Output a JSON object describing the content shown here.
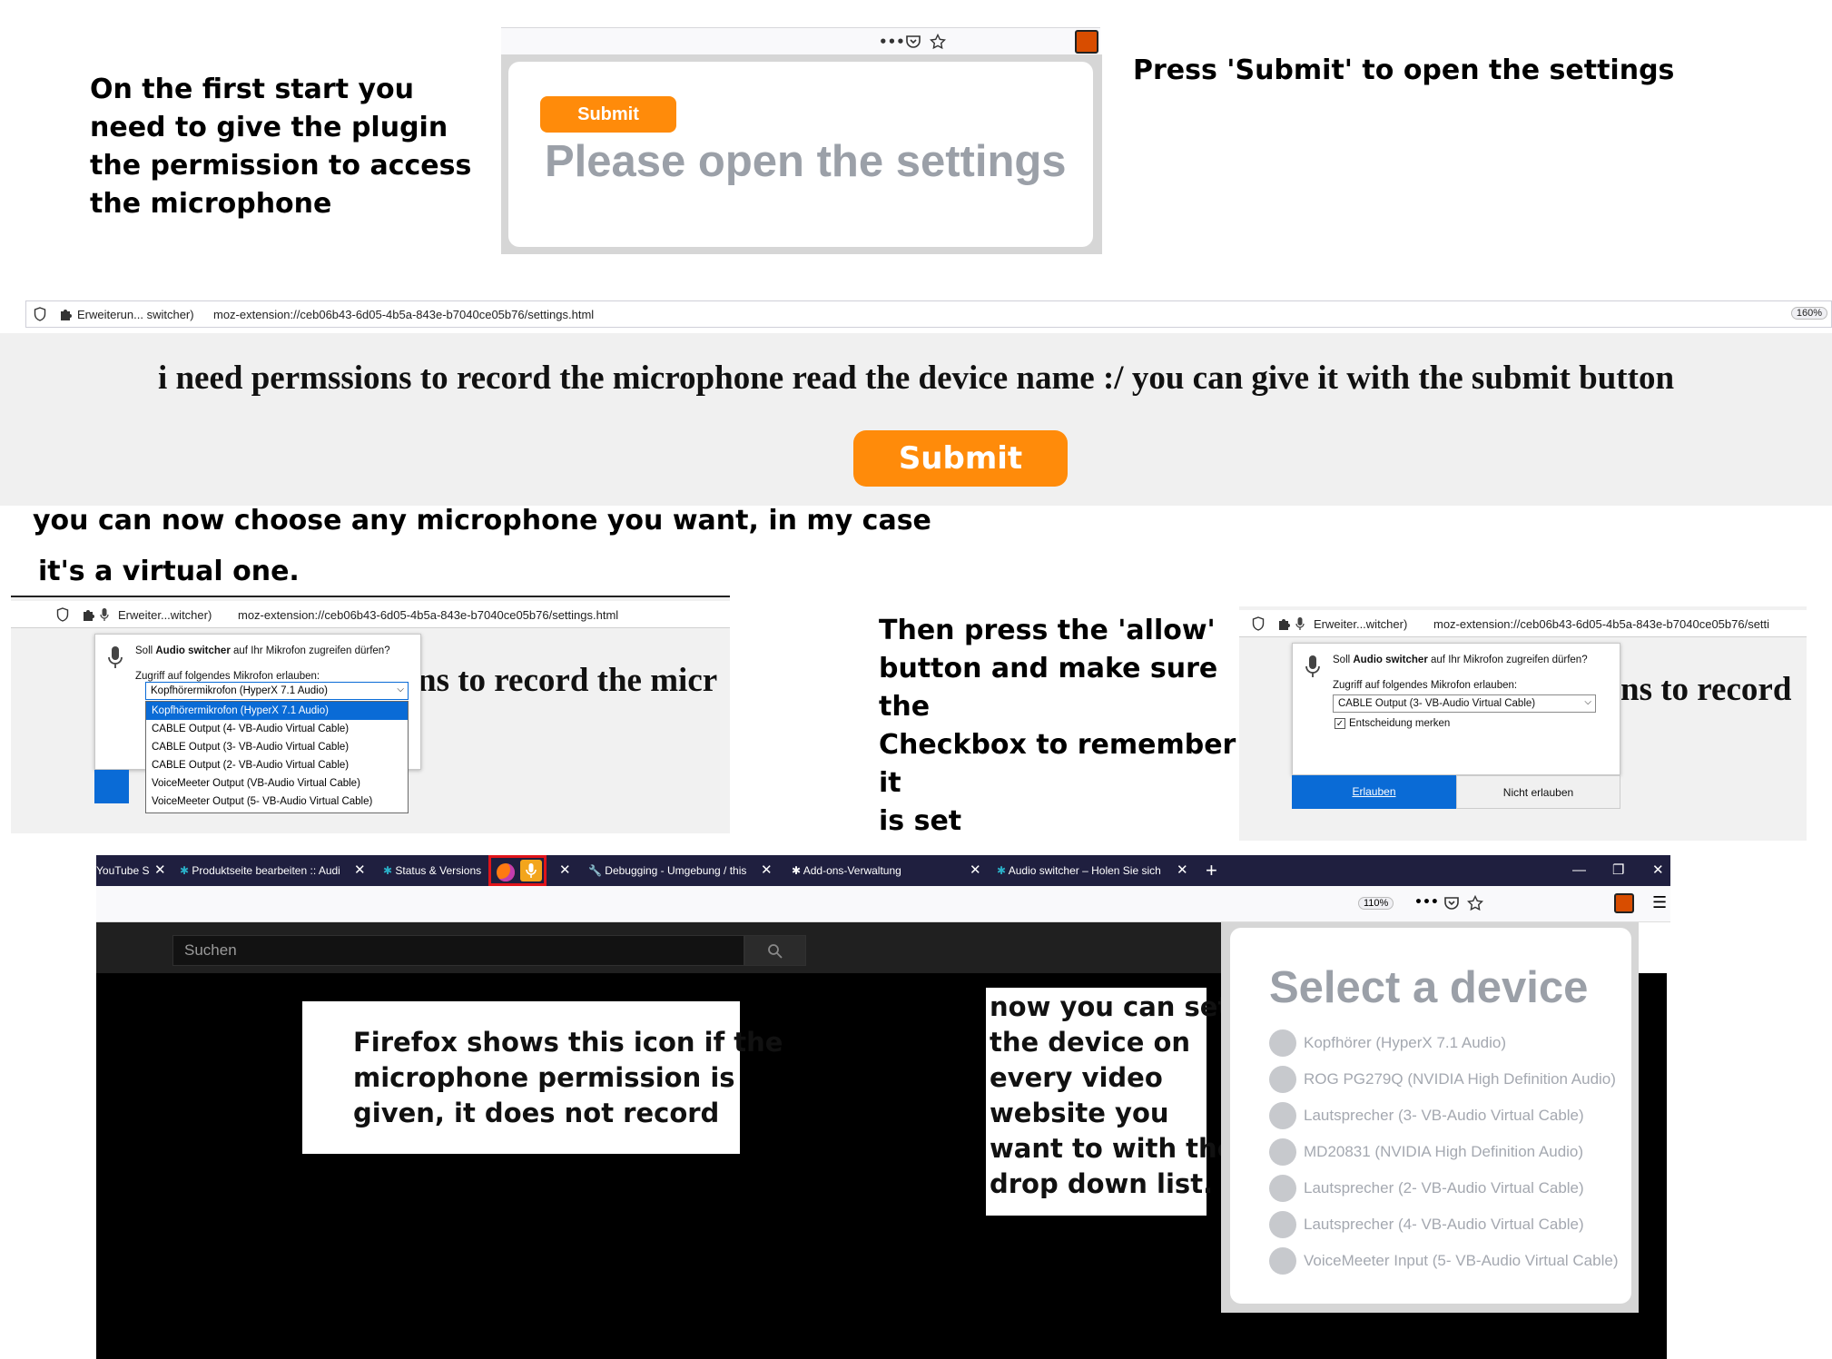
{
  "section1": {
    "caption": [
      "On the first start you",
      "need to give the plugin",
      "the permission to access",
      "the microphone"
    ],
    "toolbar_icons": [
      "more-icon",
      "pocket-icon",
      "star-icon"
    ],
    "submit_label": "Submit",
    "heading": "Please open the settings",
    "right_caption": "Press 'Submit' to open the settings"
  },
  "section2": {
    "identity_label": "Erweiterun... switcher)",
    "url": "moz-extension://ceb06b43-6d05-4b5a-843e-b7040ce05b76/settings.html",
    "zoom": "160%",
    "page_text": "i need permssions to record the microphone read the device name :/ you can give it with the submit button",
    "submit_label": "Submit"
  },
  "section3": {
    "caption_line1": "you can now choose any microphone you want, in my case",
    "caption_line2": "it's a virtual one.",
    "left": {
      "identity_label": "Erweiter...witcher)",
      "url": "moz-extension://ceb06b43-6d05-4b5a-843e-b7040ce05b76/settings.html",
      "question_pre": "Soll ",
      "question_app": "Audio switcher",
      "question_post": " auf Ihr Mikrofon zugreifen dürfen?",
      "access_label": "Zugriff auf folgendes Mikrofon erlauben:",
      "selected": "Kopfhörermikrofon (HyperX 7.1 Audio)",
      "options": [
        "Kopfhörermikrofon (HyperX 7.1 Audio)",
        "CABLE Output (4- VB-Audio Virtual Cable)",
        "CABLE Output (3- VB-Audio Virtual Cable)",
        "CABLE Output (2- VB-Audio Virtual Cable)",
        "VoiceMeeter Output (VB-Audio Virtual Cable)",
        "VoiceMeeter Output (5- VB-Audio Virtual Cable)"
      ],
      "background_text": "ns to record the micr"
    },
    "middle_caption": [
      "Then press the 'allow'",
      "button and make sure the",
      "Checkbox to remember it",
      "is set"
    ],
    "right": {
      "identity_label": "Erweiter...witcher)",
      "url": "moz-extension://ceb06b43-6d05-4b5a-843e-b7040ce05b76/setti",
      "question_pre": "Soll ",
      "question_app": "Audio switcher",
      "question_post": " auf Ihr Mikrofon zugreifen dürfen?",
      "access_label": "Zugriff auf folgendes Mikrofon erlauben:",
      "selected": "CABLE Output (3- VB-Audio Virtual Cable)",
      "remember_label": "Entscheidung merken",
      "remember_checked": true,
      "allow_label": "Erlauben",
      "deny_label": "Nicht erlauben",
      "background_text": "ns to record"
    }
  },
  "section4": {
    "tabs": [
      {
        "label": "YouTube S"
      },
      {
        "label": "Produktseite bearbeiten :: Audi"
      },
      {
        "label": "Status & Versions"
      },
      {
        "label": "Debugging - Umgebung / this"
      },
      {
        "label": "Add-ons-Verwaltung"
      },
      {
        "label": "Audio switcher – Holen Sie sich"
      }
    ],
    "new_tab_label": "+",
    "zoom": "110%",
    "search_placeholder": "Suchen",
    "note_left": [
      "Firefox shows this icon if the",
      "microphone permission is",
      "given, it does not record"
    ],
    "note_right": [
      "now you can set",
      "the device on",
      "every video",
      "website you",
      "want to with the",
      "drop down list."
    ],
    "device_title": "Select a device",
    "devices": [
      "Kopfhörer (HyperX 7.1 Audio)",
      "ROG PG279Q (NVIDIA High Definition Audio)",
      "Lautsprecher (3- VB-Audio Virtual Cable)",
      "MD20831 (NVIDIA High Definition Audio)",
      "Lautsprecher (2- VB-Audio Virtual Cable)",
      "Lautsprecher (4- VB-Audio Virtual Cable)",
      "VoiceMeeter Input (5- VB-Audio Virtual Cable)"
    ],
    "colors": {
      "accent_orange": "#ff8b0a",
      "tabbar": "#1f1f3f",
      "highlight_red": "#e0141a",
      "allow_blue": "#0a6bd6"
    }
  }
}
